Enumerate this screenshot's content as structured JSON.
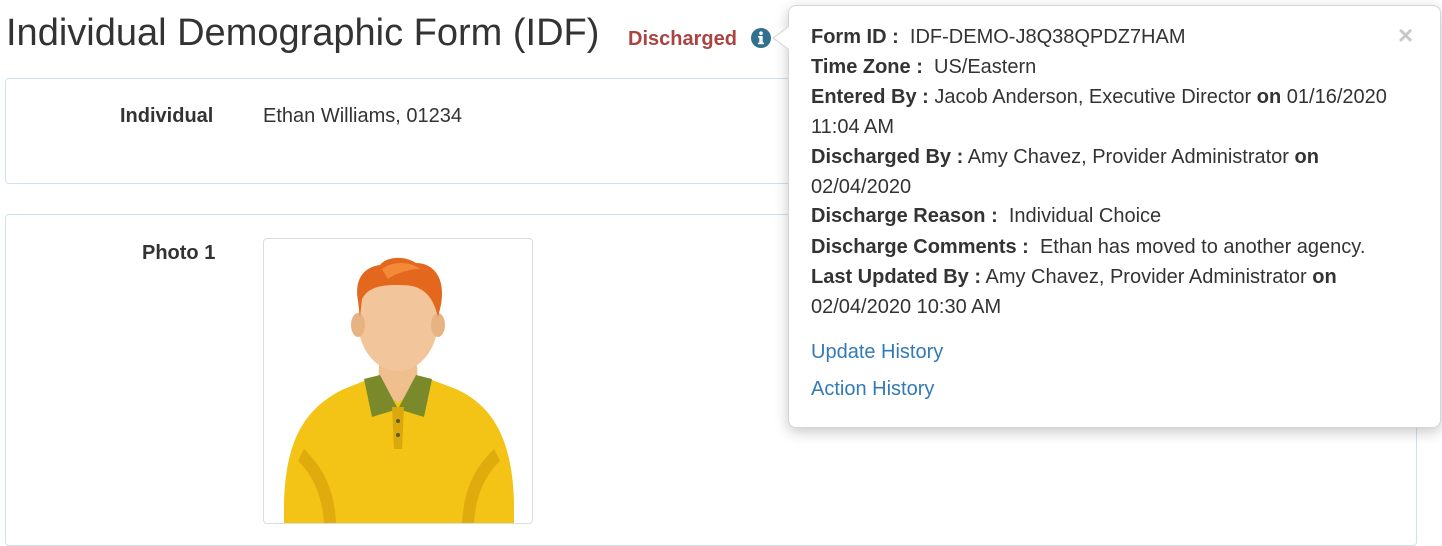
{
  "header": {
    "title": "Individual Demographic Form (IDF)",
    "status": "Discharged",
    "status_color": "#a94442",
    "info_icon": "info-circle-icon"
  },
  "individual": {
    "label": "Individual",
    "value": "Ethan Williams, 01234"
  },
  "photo": {
    "label": "Photo 1",
    "image_description_icon": "person-avatar"
  },
  "popover": {
    "close_label": "×",
    "form_id": {
      "label": "Form ID :",
      "value": "IDF-DEMO-J8Q38QPDZ7HAM"
    },
    "time_zone": {
      "label": "Time Zone :",
      "value": "US/Eastern"
    },
    "entered_by": {
      "label": "Entered By :",
      "value": "Jacob Anderson, Executive Director",
      "on_label": "on",
      "date": "01/16/2020",
      "time": "11:04 AM"
    },
    "discharged_by": {
      "label": "Discharged By :",
      "value": "Amy Chavez, Provider Administrator",
      "on_label": "on",
      "date": "02/04/2020"
    },
    "discharge_reason": {
      "label": "Discharge Reason :",
      "value": "Individual Choice"
    },
    "discharge_comments": {
      "label": "Discharge Comments :",
      "value": "Ethan has moved to another agency."
    },
    "last_updated_by": {
      "label": "Last Updated By :",
      "value": "Amy Chavez, Provider Administrator",
      "on_label": "on",
      "datetime": "02/04/2020 10:30 AM"
    },
    "links": {
      "update_history": "Update History",
      "action_history": "Action History"
    },
    "link_color": "#337ab7"
  }
}
